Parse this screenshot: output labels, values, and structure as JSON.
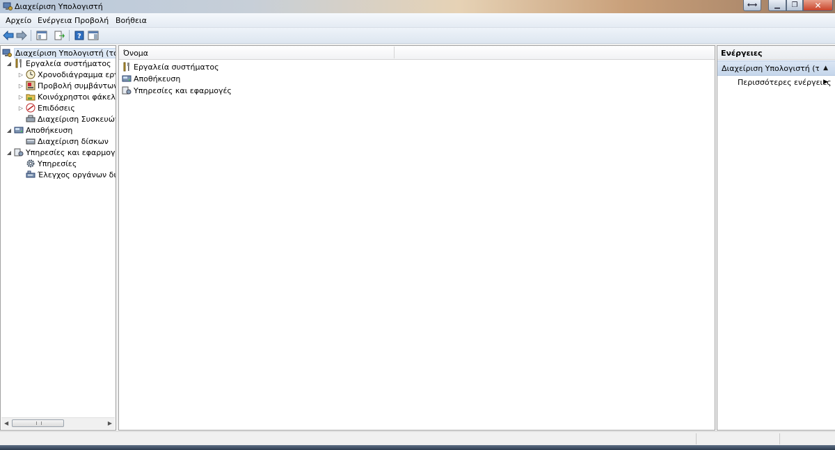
{
  "window": {
    "title": "Διαχείριση Υπολογιστή"
  },
  "menu": {
    "items": [
      "Αρχείο",
      "Ενέργεια",
      "Προβολή",
      "Βοήθεια"
    ]
  },
  "tree": {
    "items": [
      {
        "label": "Διαχείριση Υπολογιστή (τοπικ",
        "depth": 0,
        "expander": "",
        "icon": "computer-management-icon",
        "selected": true
      },
      {
        "label": "Εργαλεία συστήματος",
        "depth": 1,
        "expander": "◢",
        "icon": "tools-icon"
      },
      {
        "label": "Χρονοδιάγραμμα εργασ",
        "depth": 2,
        "expander": "▷",
        "icon": "clock-icon"
      },
      {
        "label": "Προβολή συμβάντων",
        "depth": 2,
        "expander": "▷",
        "icon": "event-viewer-icon"
      },
      {
        "label": "Κοινόχρηστοι φάκελοι",
        "depth": 2,
        "expander": "▷",
        "icon": "shared-folder-icon"
      },
      {
        "label": "Επιδόσεις",
        "depth": 2,
        "expander": "▷",
        "icon": "performance-icon"
      },
      {
        "label": "Διαχείριση Συσκευών",
        "depth": 2,
        "expander": "",
        "icon": "device-manager-icon"
      },
      {
        "label": "Αποθήκευση",
        "depth": 1,
        "expander": "◢",
        "icon": "storage-icon"
      },
      {
        "label": "Διαχείριση δίσκων",
        "depth": 2,
        "expander": "",
        "icon": "disk-icon"
      },
      {
        "label": "Υπηρεσίες και εφαρμογές",
        "depth": 1,
        "expander": "◢",
        "icon": "services-apps-icon"
      },
      {
        "label": "Υπηρεσίες",
        "depth": 2,
        "expander": "",
        "icon": "gear-icon"
      },
      {
        "label": "Έλεγχος οργάνων διαχε",
        "depth": 2,
        "expander": "",
        "icon": "wmi-icon"
      }
    ]
  },
  "list": {
    "column_name": "Όνομα",
    "rows": [
      {
        "label": "Εργαλεία συστήματος",
        "icon": "tools-icon"
      },
      {
        "label": "Αποθήκευση",
        "icon": "storage-icon"
      },
      {
        "label": "Υπηρεσίες και εφαρμογές",
        "icon": "services-apps-icon"
      }
    ]
  },
  "actions": {
    "header": "Ενέργειες",
    "section": "Διαχείριση Υπολογιστή (το...",
    "more": "Περισσότερες ενέργειες"
  },
  "colors": {
    "accent": "#1f5fa8",
    "selection": "#dde8f5"
  }
}
